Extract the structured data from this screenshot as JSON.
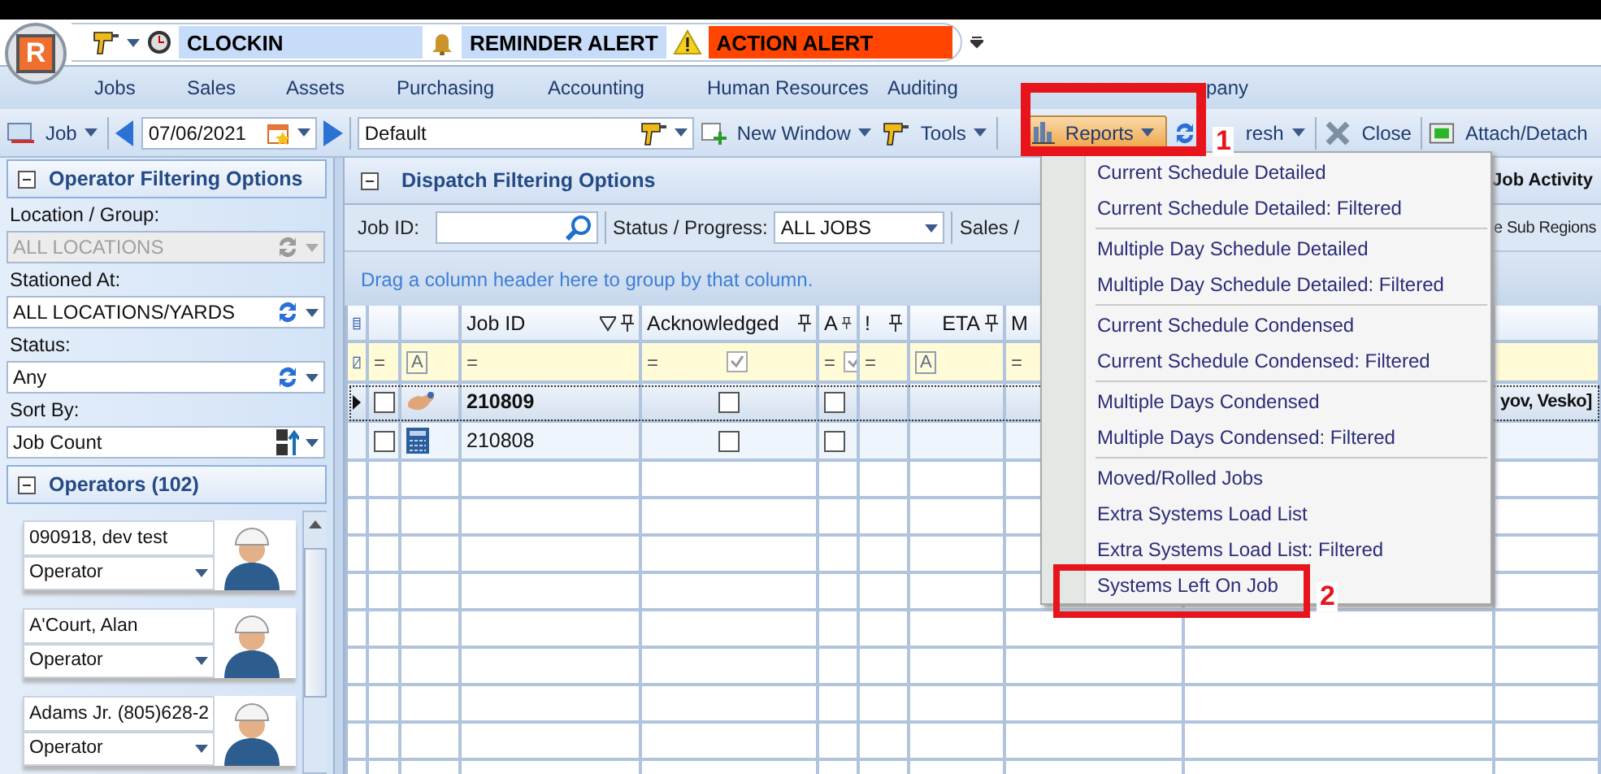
{
  "app": {
    "logo_letter": "R"
  },
  "quick_access": [
    {
      "kind": "clock",
      "label": "CLOCKIN",
      "color": "#c6dcf8"
    },
    {
      "kind": "bell",
      "label": "REMINDER ALERT",
      "color": "#c6dcf8"
    },
    {
      "kind": "warning",
      "label": "ACTION ALERT",
      "color": "#ff4500"
    }
  ],
  "menu_tabs": [
    "Jobs",
    "Sales",
    "Assets",
    "Purchasing",
    "Accounting",
    "Human Resources",
    "Auditing",
    "pany"
  ],
  "toolbar": {
    "job": "Job",
    "date": "07/06/2021",
    "layout": "Default",
    "new_window": "New Window",
    "tools": "Tools",
    "reports": {
      "label": "Reports",
      "selected": true
    },
    "refresh": "resh",
    "close": "Close",
    "attach": "Attach/Detach"
  },
  "left_panel": {
    "title": "Operator Filtering Options",
    "filters": [
      {
        "label": "Location / Group:",
        "value": "ALL LOCATIONS",
        "disabled": true,
        "kind": "refresh"
      },
      {
        "label": "Stationed At:",
        "value": "ALL LOCATIONS/YARDS",
        "disabled": false,
        "kind": "refresh"
      },
      {
        "label": "Status:",
        "value": "Any",
        "disabled": false,
        "kind": "refresh"
      },
      {
        "label": "Sort By:",
        "value": "Job Count",
        "disabled": false,
        "kind": "sort"
      }
    ],
    "operators_title": "Operators (102)",
    "operators": [
      {
        "name": "090918, dev test",
        "role": "Operator"
      },
      {
        "name": "A'Court, Alan",
        "role": "Operator"
      },
      {
        "name": "Adams Jr. (805)628-2",
        "role": "Operator"
      }
    ]
  },
  "dispatch": {
    "title": "Dispatch Filtering Options",
    "side_title": "Job Activity",
    "job_id_label": "Job ID:",
    "status_label": "Status / Progress:",
    "status_value": "ALL JOBS",
    "sales_label": "Sales /",
    "sub_regions_label": "e Sub Regions",
    "group_hint": "Drag a column header here to group by that column."
  },
  "grid": {
    "columns": [
      {
        "kind": "chooser"
      },
      {
        "kind": "check"
      },
      {
        "kind": "icon"
      },
      {
        "kind": "text",
        "label": "Job ID",
        "filtered": true,
        "pinned": true
      },
      {
        "kind": "text",
        "label": "Acknowledged",
        "filtered": false,
        "pinned": true
      },
      {
        "kind": "text",
        "label": "A",
        "filtered": false,
        "pinned": true
      },
      {
        "kind": "text",
        "label": "!",
        "filtered": false,
        "pinned": true
      },
      {
        "kind": "text",
        "label": "ETA",
        "filtered": false,
        "pinned": true
      },
      {
        "kind": "text",
        "label": "M"
      },
      {
        "kind": "blank"
      },
      {
        "kind": "blank"
      }
    ],
    "filter_row": [
      {
        "kind": "filter"
      },
      {
        "kind": "op",
        "op": "="
      },
      {
        "kind": "glyph",
        "glyph": "A"
      },
      {
        "kind": "op",
        "op": "="
      },
      {
        "kind": "opcheck",
        "op": "=",
        "checked": true
      },
      {
        "kind": "opcheck",
        "op": "=",
        "checked": true
      },
      {
        "kind": "op",
        "op": "="
      },
      {
        "kind": "glyph",
        "glyph": "A"
      },
      {
        "kind": "op",
        "op": "="
      },
      {
        "kind": "blank"
      },
      {
        "kind": "blank"
      }
    ],
    "rows": [
      {
        "selected": true,
        "checked": false,
        "kind": "hand",
        "job_id": "210809",
        "acknowledged": false,
        "a": false,
        "extra": "yov, Vesko]"
      },
      {
        "selected": false,
        "checked": false,
        "kind": "calculator",
        "job_id": "210808",
        "acknowledged": false,
        "a": false
      }
    ]
  },
  "reports_menu": {
    "groups": [
      [
        "Current Schedule Detailed",
        "Current Schedule Detailed: Filtered"
      ],
      [
        "Multiple Day Schedule Detailed",
        "Multiple Day Schedule Detailed: Filtered"
      ],
      [
        "Current Schedule Condensed",
        "Current Schedule Condensed: Filtered"
      ],
      [
        "Multiple Days Condensed",
        "Multiple Days Condensed: Filtered"
      ],
      [
        "Moved/Rolled Jobs",
        "Extra Systems Load List",
        "Extra Systems Load List: Filtered",
        "Systems Left On Job"
      ]
    ]
  },
  "annotations": [
    {
      "label": "1"
    },
    {
      "label": "2"
    }
  ]
}
